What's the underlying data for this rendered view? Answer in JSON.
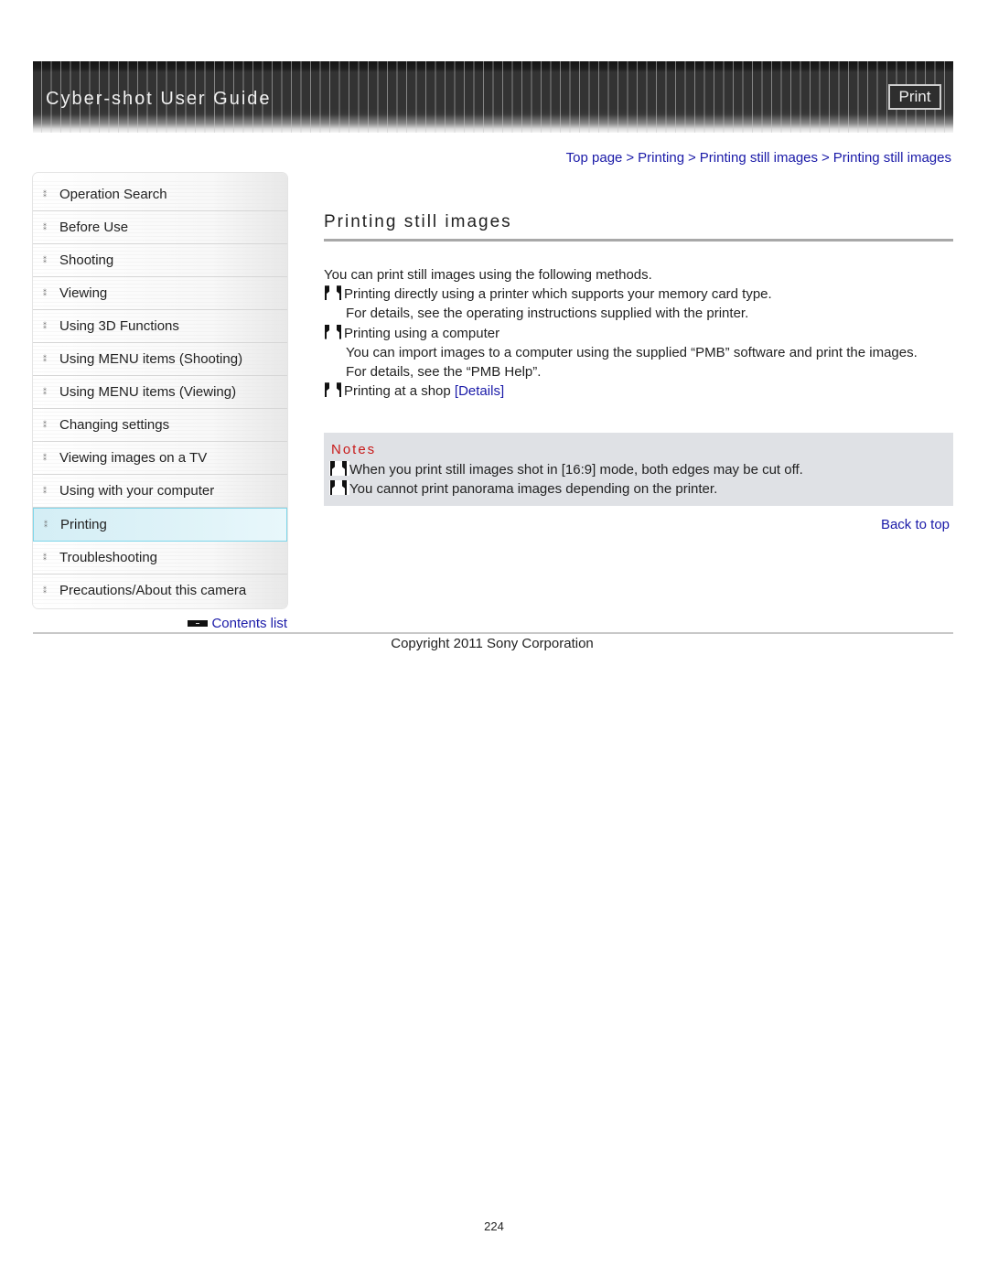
{
  "header": {
    "title": "Cyber-shot User Guide",
    "print_label": "Print"
  },
  "breadcrumb": [
    {
      "label": "Top page"
    },
    {
      "label": "Printing"
    },
    {
      "label": "Printing still images"
    },
    {
      "label": "Printing still images"
    }
  ],
  "breadcrumb_separator": ">",
  "sidebar": {
    "items": [
      {
        "label": "Operation Search",
        "active": false
      },
      {
        "label": "Before Use",
        "active": false
      },
      {
        "label": "Shooting",
        "active": false
      },
      {
        "label": "Viewing",
        "active": false
      },
      {
        "label": "Using 3D Functions",
        "active": false
      },
      {
        "label": "Using MENU items (Shooting)",
        "active": false
      },
      {
        "label": "Using MENU items (Viewing)",
        "active": false
      },
      {
        "label": "Changing settings",
        "active": false
      },
      {
        "label": "Viewing images on a TV",
        "active": false
      },
      {
        "label": "Using with your computer",
        "active": false
      },
      {
        "label": "Printing",
        "active": true
      },
      {
        "label": "Troubleshooting",
        "active": false
      },
      {
        "label": "Precautions/About this camera",
        "active": false
      }
    ],
    "contents_link": "Contents list"
  },
  "main": {
    "title": "Printing still images",
    "intro": "You can print still images using the following methods.",
    "methods": [
      {
        "heading": "Printing directly using a printer which supports your memory card type.",
        "details": [
          "For details, see the operating instructions supplied with the printer."
        ]
      },
      {
        "heading": "Printing using a computer",
        "details": [
          "You can import images to a computer using the supplied “PMB” software and print the images.",
          "For details, see the “PMB Help”."
        ]
      },
      {
        "heading": "Printing at a shop ",
        "link": "[Details]",
        "details": []
      }
    ],
    "notes": {
      "title": "Notes",
      "items": [
        "When you print still images shot in [16:9] mode, both edges may be cut off.",
        "You cannot print panorama images depending on the printer."
      ]
    },
    "back_to_top": "Back to top"
  },
  "footer": {
    "copyright": "Copyright 2011 Sony Corporation",
    "page_number": "224"
  }
}
